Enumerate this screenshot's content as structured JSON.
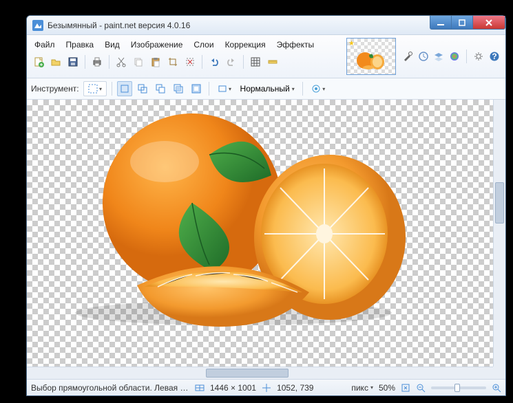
{
  "title": "Безымянный - paint.net версия 4.0.16",
  "menu": {
    "file": "Файл",
    "edit": "Правка",
    "view": "Вид",
    "image": "Изображение",
    "layers": "Слои",
    "adjust": "Коррекция",
    "effects": "Эффекты"
  },
  "tooloptions": {
    "label": "Инструмент:",
    "blend_label": "Нормальный"
  },
  "status": {
    "hint": "Выбор прямоугольной области. Левая кнопка - выделе...",
    "size": "1446 × 1001",
    "cursor": "1052, 739",
    "unit": "пикс",
    "zoom": "50%"
  }
}
